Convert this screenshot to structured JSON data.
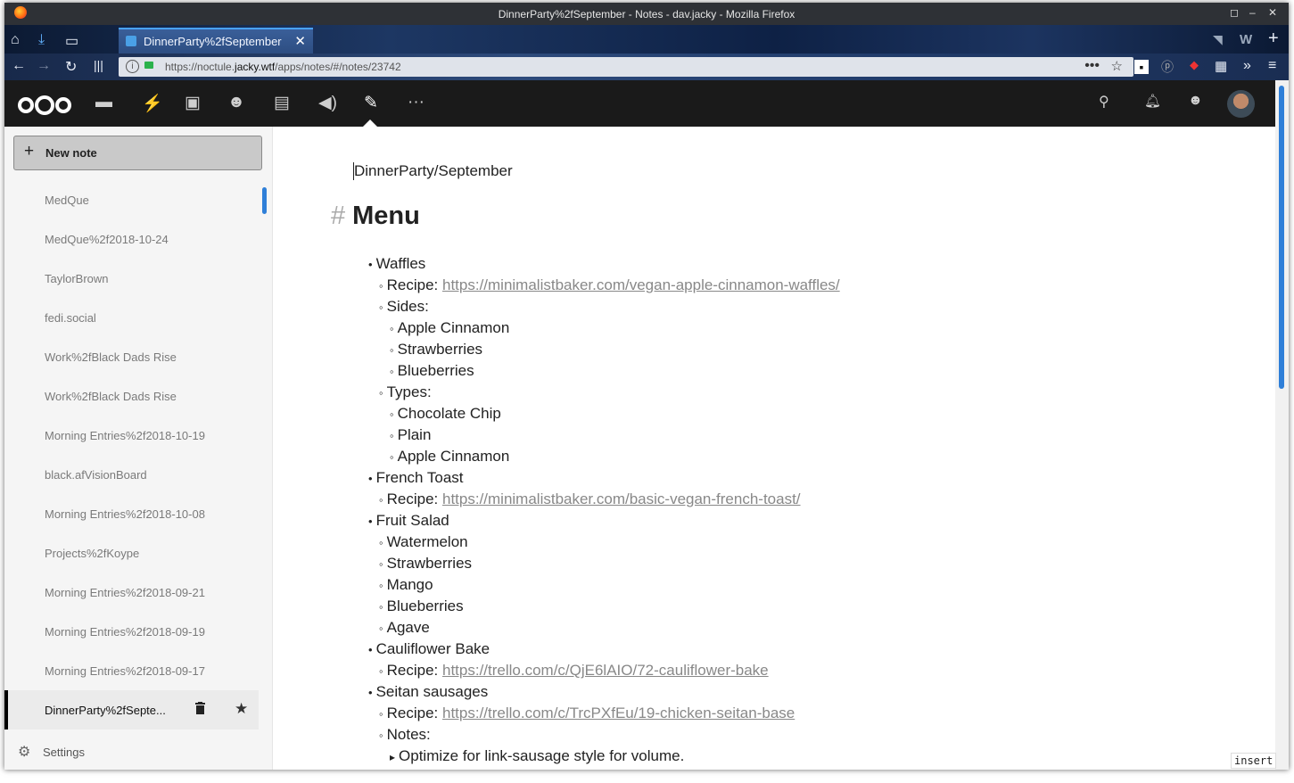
{
  "window": {
    "title": "DinnerParty%2fSeptember - Notes - dav.jacky - Mozilla Firefox",
    "tab_title": "DinnerParty%2fSeptember",
    "url_prefix": "https://noctule.",
    "url_host": "jacky.wtf",
    "url_path": "/apps/notes/#/notes/23742"
  },
  "sidebar": {
    "new_note_label": "New note",
    "notes": [
      "MedQue",
      "MedQue%2f2018-10-24",
      "TaylorBrown",
      "fedi.social",
      "Work%2fBlack Dads Rise",
      "Work%2fBlack Dads Rise",
      "Morning Entries%2f2018-10-19",
      "black.afVisionBoard",
      "Morning Entries%2f2018-10-08",
      "Projects%2fKoype",
      "Morning Entries%2f2018-09-21",
      "Morning Entries%2f2018-09-19",
      "Morning Entries%2f2018-09-17",
      "DinnerParty%2fSepte..."
    ],
    "settings_label": "Settings"
  },
  "editor": {
    "title": "DinnerParty/September",
    "heading_mark": "#",
    "heading": "Menu",
    "lines": [
      {
        "bullet": "•",
        "text": "Waffles"
      },
      {
        "bullet": "◦",
        "text": "Recipe: ",
        "link": "https://minimalistbaker.com/vegan-apple-cinnamon-waffles/"
      },
      {
        "bullet": "◦",
        "text": "Sides:"
      },
      {
        "bullet": "◦",
        "text": "Apple Cinnamon"
      },
      {
        "bullet": "◦",
        "text": "Strawberries"
      },
      {
        "bullet": "◦",
        "text": "Blueberries"
      },
      {
        "bullet": "◦",
        "text": "Types:"
      },
      {
        "bullet": "◦",
        "text": "Chocolate Chip"
      },
      {
        "bullet": "◦",
        "text": "Plain"
      },
      {
        "bullet": "◦",
        "text": "Apple Cinnamon"
      },
      {
        "bullet": "•",
        "text": "French Toast"
      },
      {
        "bullet": "◦",
        "text": "Recipe: ",
        "link": "https://minimalistbaker.com/basic-vegan-french-toast/"
      },
      {
        "bullet": "•",
        "text": "Fruit Salad"
      },
      {
        "bullet": "◦",
        "text": "Watermelon"
      },
      {
        "bullet": "◦",
        "text": "Strawberries"
      },
      {
        "bullet": "◦",
        "text": "Mango"
      },
      {
        "bullet": "◦",
        "text": "Blueberries"
      },
      {
        "bullet": "◦",
        "text": "Agave"
      },
      {
        "bullet": "•",
        "text": "Cauliflower Bake"
      },
      {
        "bullet": "◦",
        "text": "Recipe: ",
        "link": "https://trello.com/c/QjE6lAIO/72-cauliflower-bake"
      },
      {
        "bullet": "•",
        "text": "Seitan sausages"
      },
      {
        "bullet": "◦",
        "text": "Recipe: ",
        "link": "https://trello.com/c/TrcPXfEu/19-chicken-seitan-base"
      },
      {
        "bullet": "◦",
        "text": "Notes:"
      },
      {
        "bullet": "▸",
        "text": "Optimize for link-sausage style for volume."
      }
    ],
    "mode": "insert"
  },
  "colors": {
    "accent": "#2f7fd8",
    "header_bg": "#1a1a1a"
  }
}
